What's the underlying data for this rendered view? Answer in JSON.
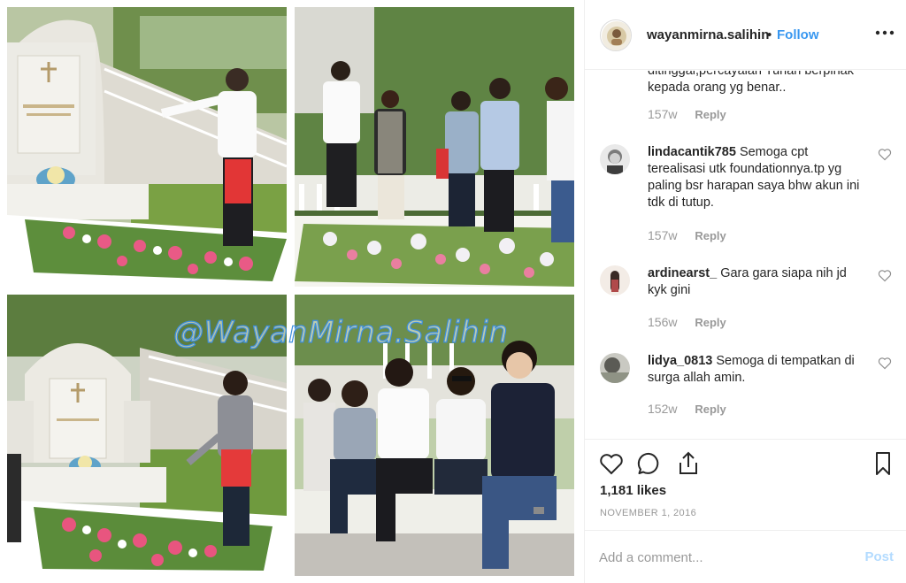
{
  "post": {
    "username": "wayanmirna.salihin",
    "separator": "•",
    "follow_label": "Follow",
    "more_icon": "more-horizontal-icon",
    "watermark": "@WayanMirna.Salihin"
  },
  "comments": {
    "partial_text": "ditinggal,percayalah Tuhan berpihak kepada orang yg benar..",
    "partial_meta": {
      "age": "157w",
      "reply": "Reply"
    },
    "items": [
      {
        "user": "lindacantik785",
        "text": "Semoga cpt terealisasi utk foundationnya.tp yg paling bsr harapan saya bhw akun ini tdk di tutup.",
        "age": "157w",
        "reply": "Reply"
      },
      {
        "user": "ardinearst_",
        "text": "Gara gara siapa nih jd kyk gini",
        "age": "156w",
        "reply": "Reply"
      },
      {
        "user": "lidya_0813",
        "text": "Semoga di tempatkan di surga allah amin.",
        "age": "152w",
        "reply": "Reply"
      }
    ]
  },
  "actions": {
    "like_icon": "heart-icon",
    "comment_icon": "comment-icon",
    "share_icon": "share-icon",
    "save_icon": "bookmark-icon",
    "likes": "1,181 likes",
    "date": "NOVEMBER 1, 2016"
  },
  "add_comment": {
    "placeholder": "Add a comment...",
    "post_label": "Post"
  },
  "colors": {
    "link": "#3897f0",
    "muted": "#999999",
    "post_disabled": "#b3dbff",
    "border": "#efefef"
  }
}
